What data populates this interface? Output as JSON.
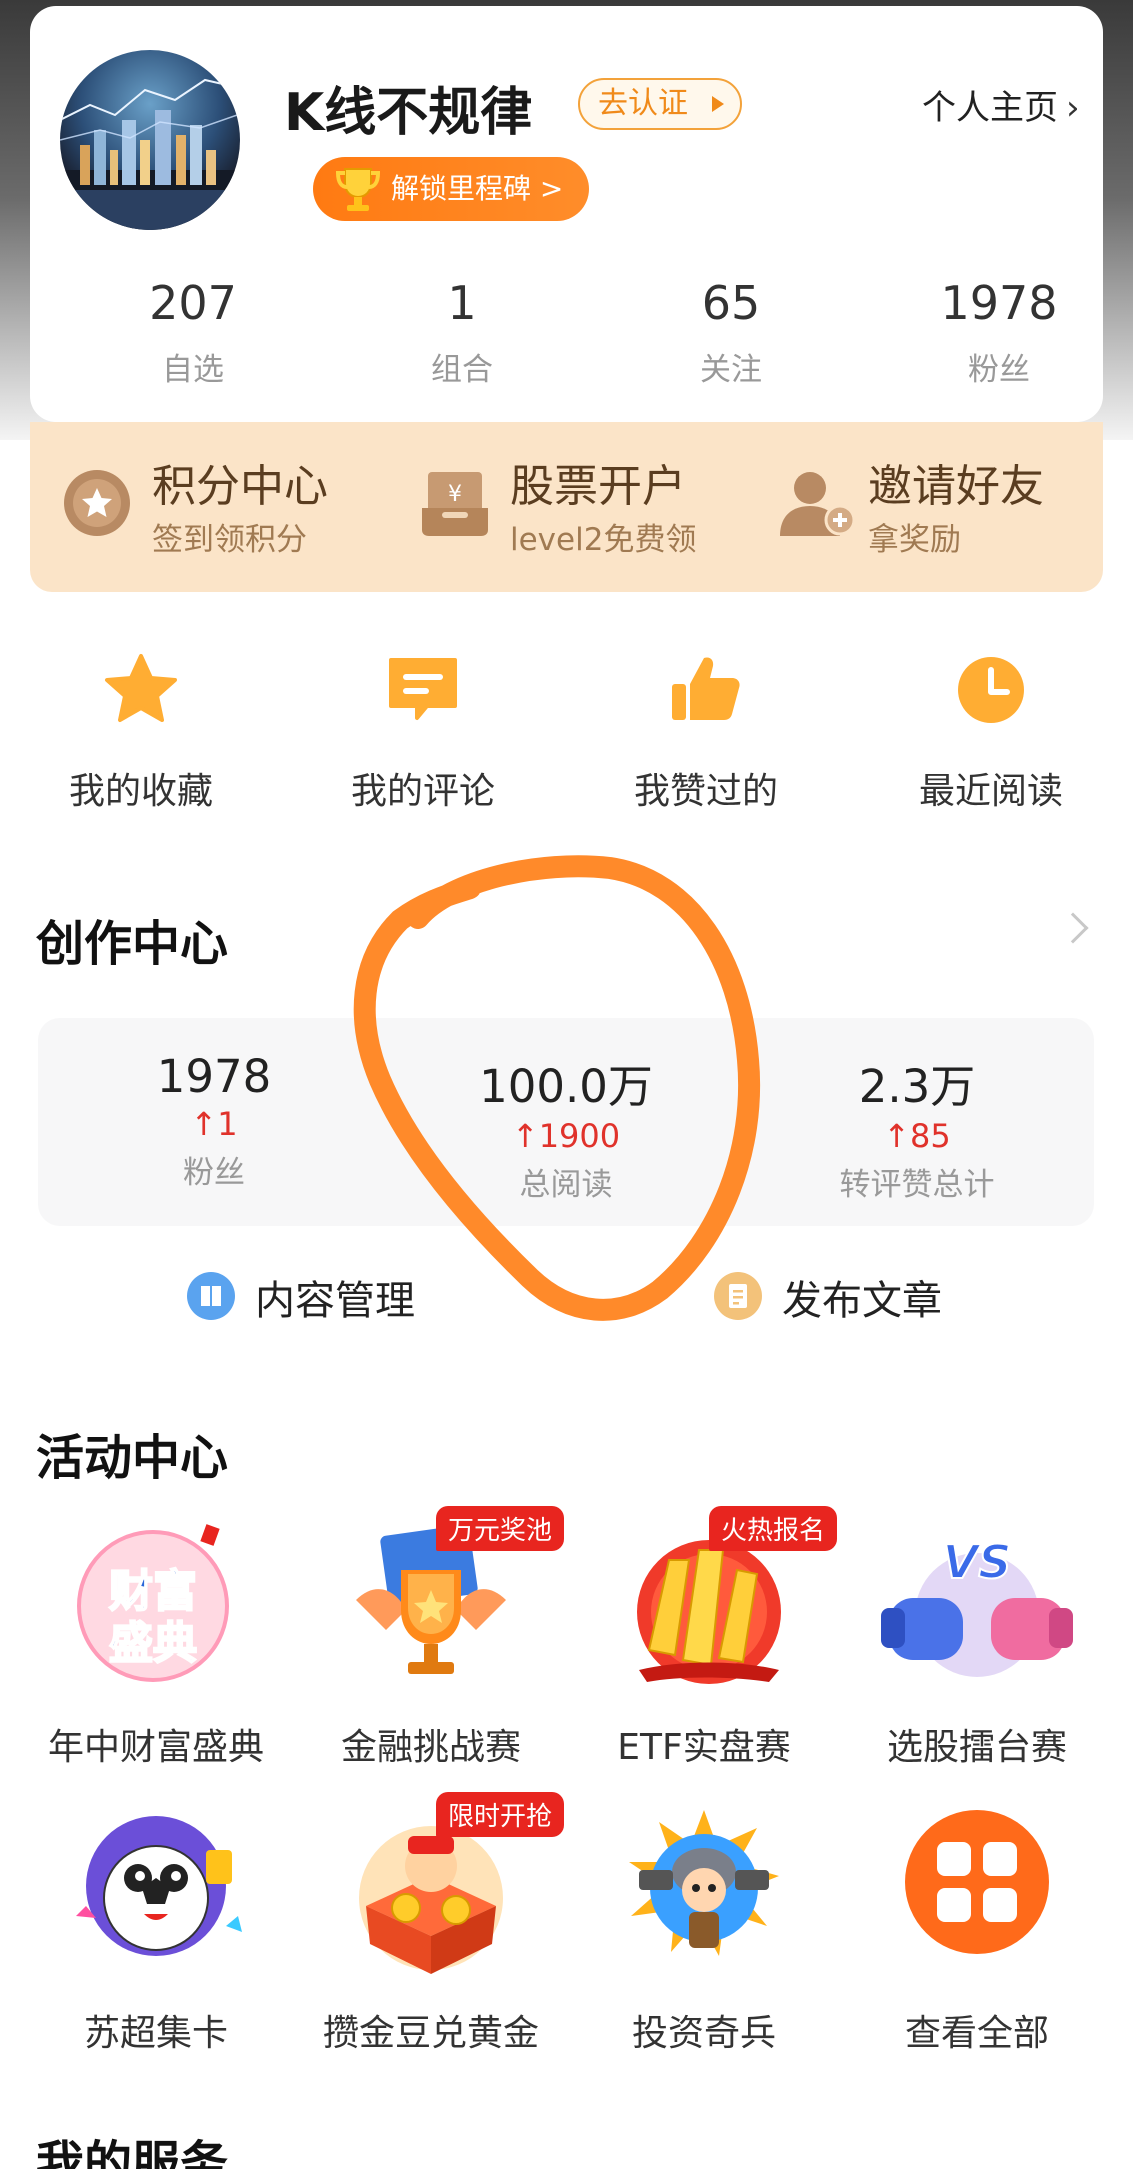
{
  "profile": {
    "username": "K线不规律",
    "verify_label": "去认证",
    "homepage_label": "个人主页",
    "milestone_label": "解锁里程碑 >",
    "stats": [
      {
        "value": "207",
        "label": "自选"
      },
      {
        "value": "1",
        "label": "组合"
      },
      {
        "value": "65",
        "label": "关注"
      },
      {
        "value": "1978",
        "label": "粉丝"
      }
    ]
  },
  "promos": [
    {
      "title": "积分中心",
      "sub": "签到领积分",
      "icon": "star-badge-icon"
    },
    {
      "title": "股票开户",
      "sub": "level2免费领",
      "icon": "yuan-box-icon"
    },
    {
      "title": "邀请好友",
      "sub": "拿奖励",
      "icon": "add-person-icon"
    }
  ],
  "quick_links": [
    {
      "label": "我的收藏",
      "icon": "star-icon"
    },
    {
      "label": "我的评论",
      "icon": "comment-icon"
    },
    {
      "label": "我赞过的",
      "icon": "thumbs-up-icon"
    },
    {
      "label": "最近阅读",
      "icon": "clock-icon"
    }
  ],
  "creator": {
    "title": "创作中心",
    "stats": [
      {
        "value": "1978",
        "delta": "1",
        "label": "粉丝"
      },
      {
        "value": "100.0万",
        "delta": "1900",
        "label": "总阅读"
      },
      {
        "value": "2.3万",
        "delta": "85",
        "label": "转评赞总计"
      }
    ],
    "actions": [
      {
        "label": "内容管理",
        "icon": "book-icon"
      },
      {
        "label": "发布文章",
        "icon": "document-icon"
      }
    ]
  },
  "activities": {
    "title": "活动中心",
    "items": [
      {
        "label": "年中财富盛典",
        "tag": "",
        "art_text_1": "财富",
        "art_text_2": "盛典"
      },
      {
        "label": "金融挑战赛",
        "tag": "万元奖池"
      },
      {
        "label": "ETF实盘赛",
        "tag": "火热报名"
      },
      {
        "label": "选股擂台赛",
        "tag": "",
        "art_text_1": "VS"
      },
      {
        "label": "苏超集卡",
        "tag": ""
      },
      {
        "label": "攒金豆兑黄金",
        "tag": "限时开抢"
      },
      {
        "label": "投资奇兵",
        "tag": ""
      },
      {
        "label": "查看全部",
        "tag": ""
      }
    ]
  },
  "services": {
    "title": "我的服务"
  },
  "colors": {
    "accent_orange": "#ff7a12",
    "promo_bg": "#fbe4c8",
    "delta_red": "#e0322b",
    "annotation_orange": "#ff8a2a"
  }
}
